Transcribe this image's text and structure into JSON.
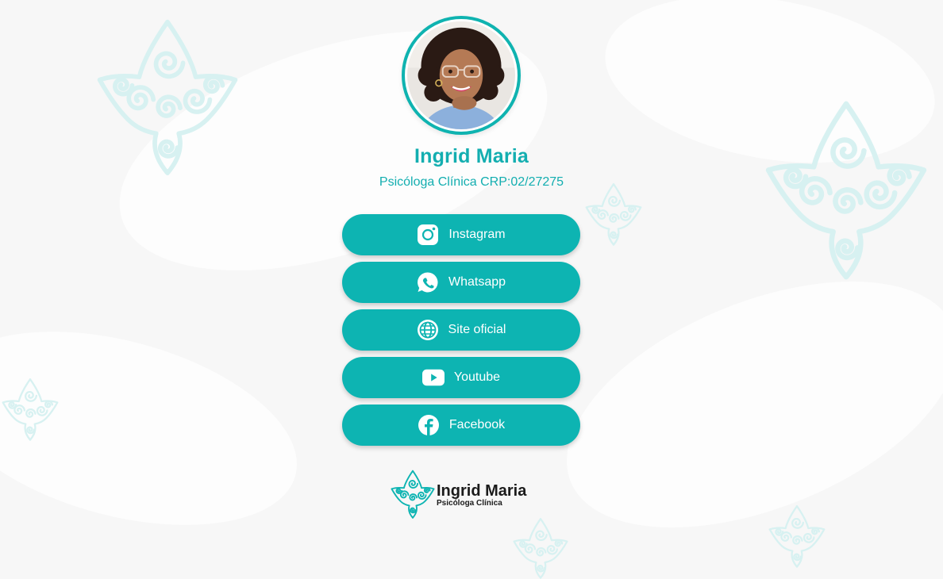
{
  "profile": {
    "name": "Ingrid Maria",
    "subtitle": "Psicóloga Clínica CRP:02/27275",
    "avatar_alt": "Ingrid Maria"
  },
  "links": [
    {
      "label": "Instagram",
      "icon": "instagram-icon"
    },
    {
      "label": "Whatsapp",
      "icon": "whatsapp-icon"
    },
    {
      "label": "Site oficial",
      "icon": "globe-icon"
    },
    {
      "label": "Youtube",
      "icon": "youtube-icon"
    },
    {
      "label": "Facebook",
      "icon": "facebook-icon"
    }
  ],
  "footer": {
    "brand_name": "Ingrid Maria",
    "brand_sub": "Psicóloga Clínica",
    "logo_icon": "spiral-flower-logo-icon"
  },
  "colors": {
    "accent": "#0db4b2",
    "accent_text": "#13aeb0",
    "button_text": "#ffffff",
    "background": "#f7f7f7",
    "motif": "#d7f1f1"
  }
}
